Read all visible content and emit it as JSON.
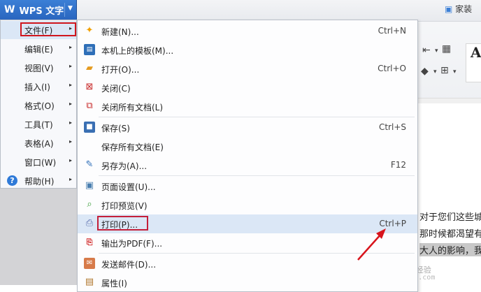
{
  "app": {
    "title": "WPS 文字",
    "logo": "W"
  },
  "ribbon": {
    "tab_home": "家装",
    "font_preview": "Aa"
  },
  "document": {
    "lines": [
      "对于您们这些城",
      "那时候都渴望有",
      "大人的影响，我"
    ]
  },
  "watermark": {
    "cn": "Baidu 经验",
    "url": "jingyan.baidu.com"
  },
  "main_menu": {
    "items": [
      {
        "label": "文件(F)",
        "active": true
      },
      {
        "label": "编辑(E)"
      },
      {
        "label": "视图(V)"
      },
      {
        "label": "插入(I)"
      },
      {
        "label": "格式(O)"
      },
      {
        "label": "工具(T)"
      },
      {
        "label": "表格(A)"
      },
      {
        "label": "窗口(W)"
      },
      {
        "label": "帮助(H)",
        "icon": "help-icon"
      }
    ],
    "arrow": "▸",
    "help_glyph": "?"
  },
  "file_menu": {
    "items": [
      {
        "label": "新建(N)...",
        "shortcut": "Ctrl+N",
        "icon": "new-document-icon"
      },
      {
        "label": "本机上的模板(M)...",
        "shortcut": "",
        "icon": "template-icon"
      },
      {
        "label": "打开(O)...",
        "shortcut": "Ctrl+O",
        "icon": "open-folder-icon"
      },
      {
        "label": "关闭(C)",
        "shortcut": "",
        "icon": "close-document-icon"
      },
      {
        "label": "关闭所有文档(L)",
        "shortcut": "",
        "icon": "close-all-icon"
      },
      {
        "label": "保存(S)",
        "shortcut": "Ctrl+S",
        "icon": "save-icon"
      },
      {
        "label": "保存所有文档(E)",
        "shortcut": "",
        "icon": ""
      },
      {
        "label": "另存为(A)...",
        "shortcut": "F12",
        "icon": "save-as-icon"
      },
      {
        "label": "页面设置(U)...",
        "shortcut": "",
        "icon": "page-setup-icon"
      },
      {
        "label": "打印预览(V)",
        "shortcut": "",
        "icon": "print-preview-icon"
      },
      {
        "label": "打印(P)...",
        "shortcut": "Ctrl+P",
        "icon": "printer-icon",
        "active": true
      },
      {
        "label": "输出为PDF(F)...",
        "shortcut": "",
        "icon": "pdf-icon"
      },
      {
        "label": "发送邮件(D)...",
        "shortcut": "",
        "icon": "mail-icon"
      },
      {
        "label": "属性(I)",
        "shortcut": "",
        "icon": "properties-icon"
      }
    ]
  },
  "colors": {
    "accent_blue": "#2a66bf",
    "highlight_red": "#d0161d",
    "menu_hover": "#dbe7f6"
  }
}
